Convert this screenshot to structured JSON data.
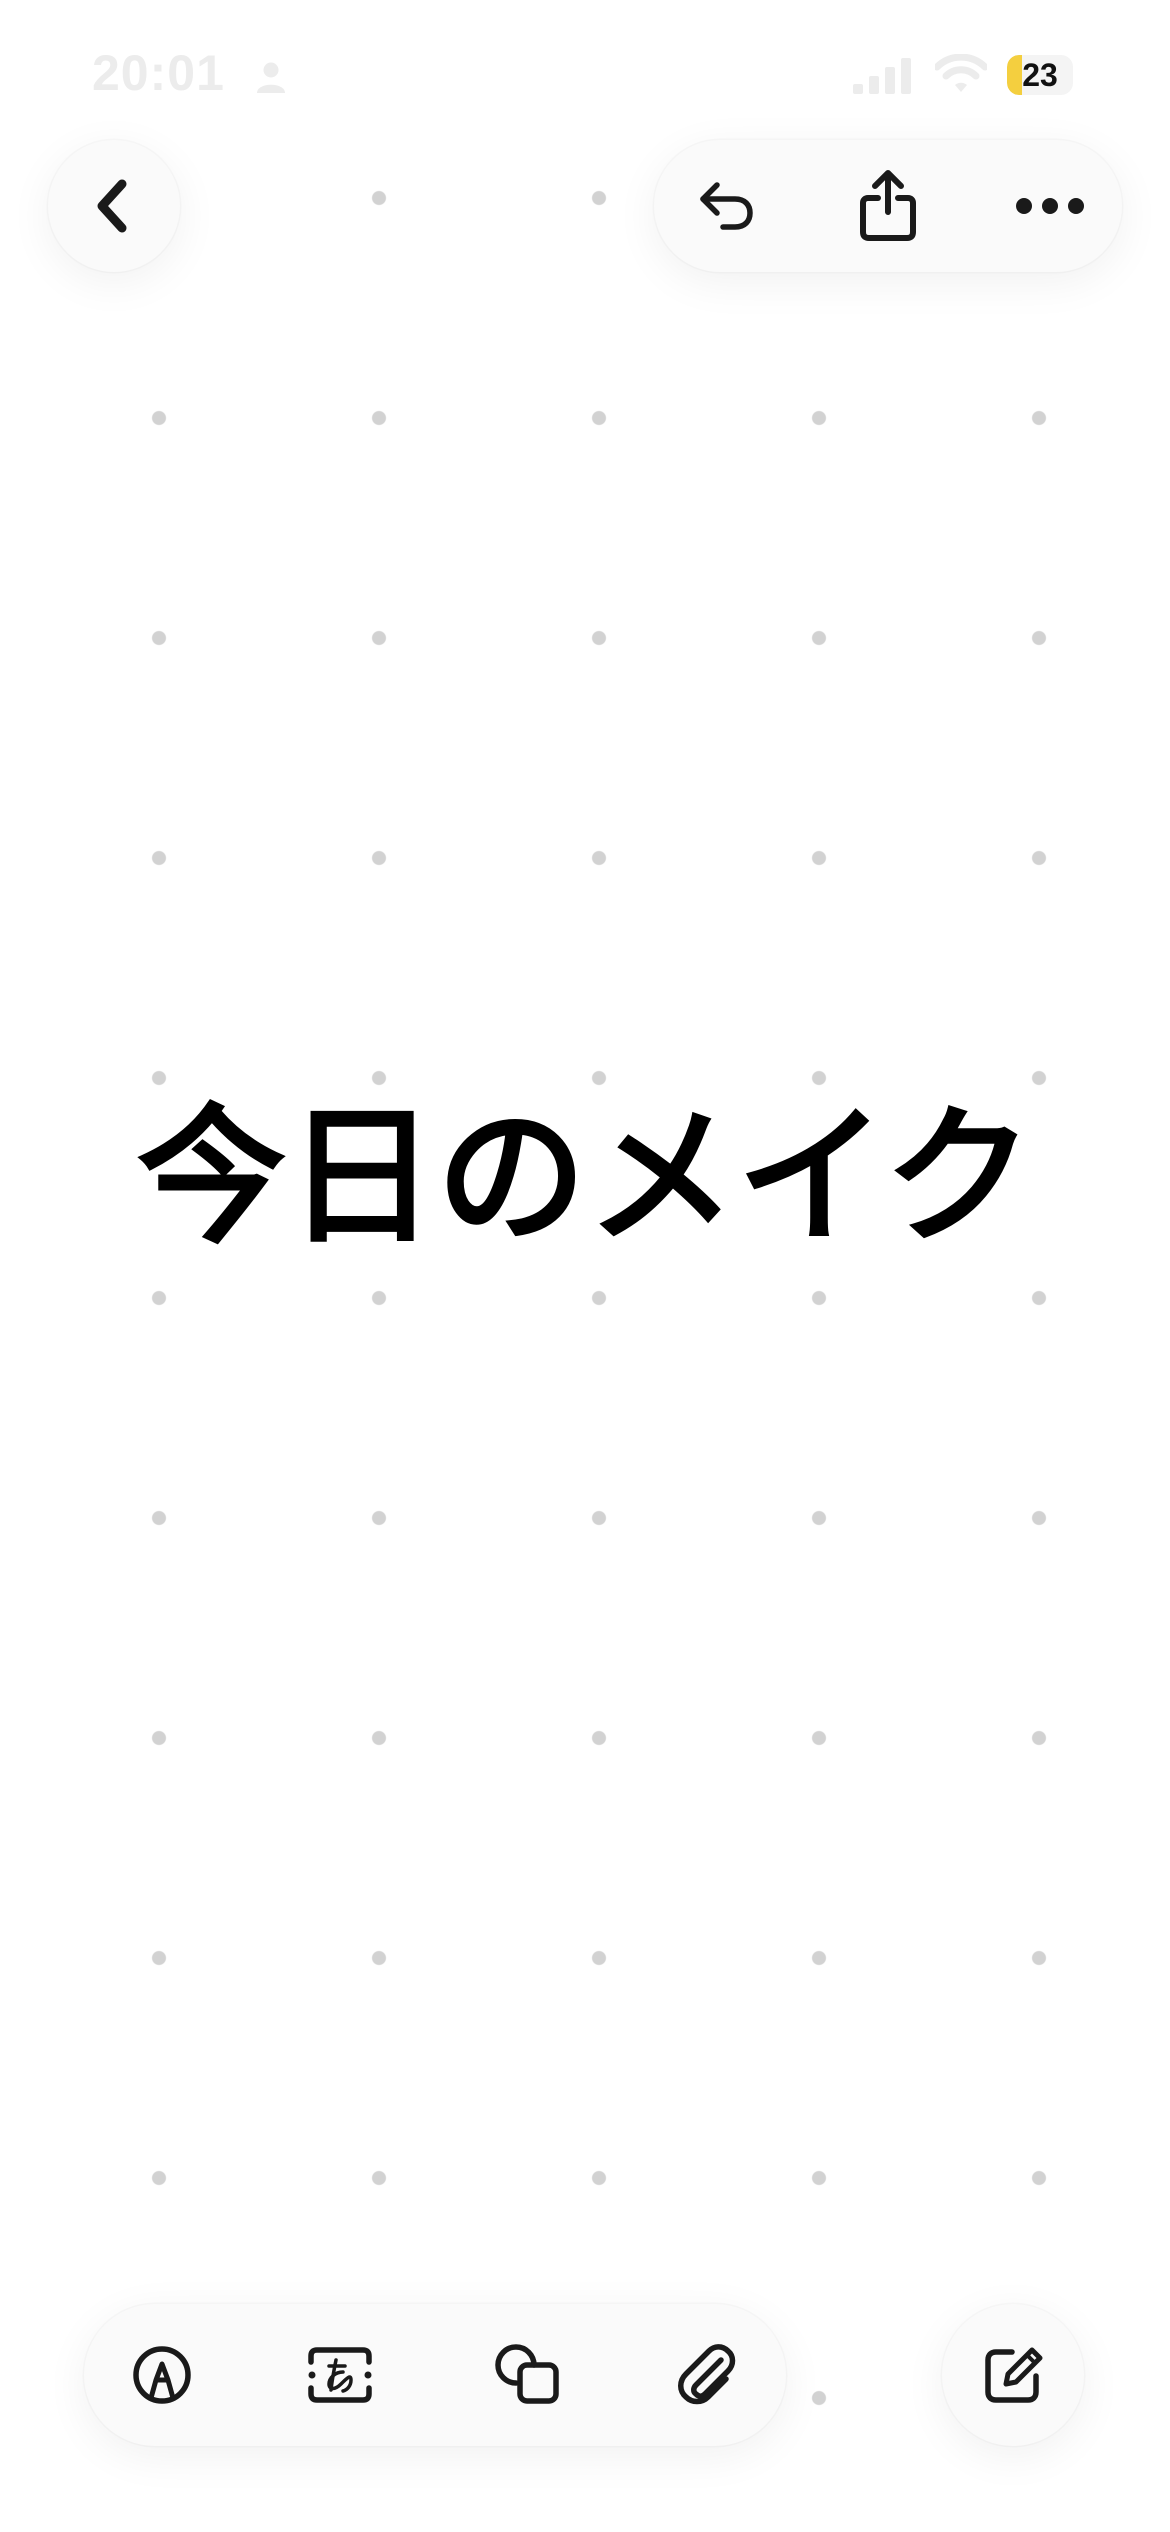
{
  "status_bar": {
    "time": "20:01",
    "battery_level": "23",
    "battery_fraction": 0.23
  },
  "icons": {
    "status": [
      "person-icon",
      "cellular-signal-icon",
      "wifi-icon",
      "battery-icon"
    ],
    "top": [
      "chevron-left-icon",
      "undo-icon",
      "share-icon",
      "more-icon"
    ],
    "bottom": [
      "pen-marker-icon",
      "text-box-icon",
      "shapes-icon",
      "paperclip-icon",
      "compose-icon"
    ]
  },
  "canvas": {
    "title": "今日のメイク",
    "background": "dot-grid"
  },
  "colors": {
    "background": "#ffffff",
    "dot": "#d2d2d2",
    "battery_accent": "#f4cf3f",
    "ink": "#111111"
  }
}
